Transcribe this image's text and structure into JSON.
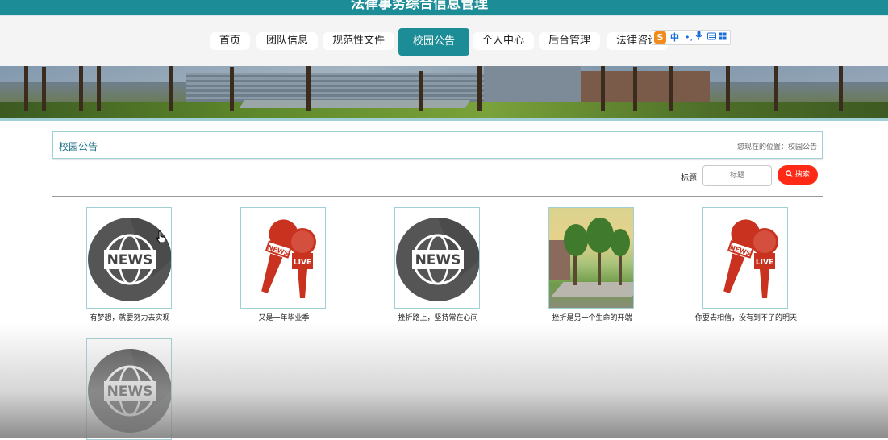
{
  "app": {
    "title": "法律事务综合信息管理"
  },
  "nav": {
    "items": [
      "首页",
      "团队信息",
      "规范性文件",
      "校园公告",
      "个人中心",
      "后台管理",
      "法律咨询"
    ],
    "active_index": 3
  },
  "ime": {
    "logo": "S",
    "zh": "中",
    "dot": "•,",
    "mic": "🎤",
    "kb": "▤",
    "grid": "▦"
  },
  "section": {
    "title": "校园公告",
    "breadcrumb": "您现在的位置：校园公告"
  },
  "search": {
    "label": "标题",
    "placeholder": "标题",
    "button_label": "搜索",
    "button_icon": "search-icon"
  },
  "cards": [
    {
      "caption": "有梦想，就要努力去实现",
      "image": "news-globe-icon"
    },
    {
      "caption": "又是一年毕业季",
      "image": "news-microphone-icon"
    },
    {
      "caption": "挫折路上，坚持常在心间",
      "image": "news-globe-icon"
    },
    {
      "caption": "挫折是另一个生命的开端",
      "image": "campus-photo"
    },
    {
      "caption": "你要去相信，没有到不了的明天",
      "image": "news-microphone-icon"
    },
    {
      "caption": "",
      "image": "news-globe-icon"
    }
  ],
  "colors": {
    "primary": "#1c8c96",
    "search_button": "#ff2a16",
    "mic_red": "#c8321f",
    "globe_dark": "#555555"
  }
}
